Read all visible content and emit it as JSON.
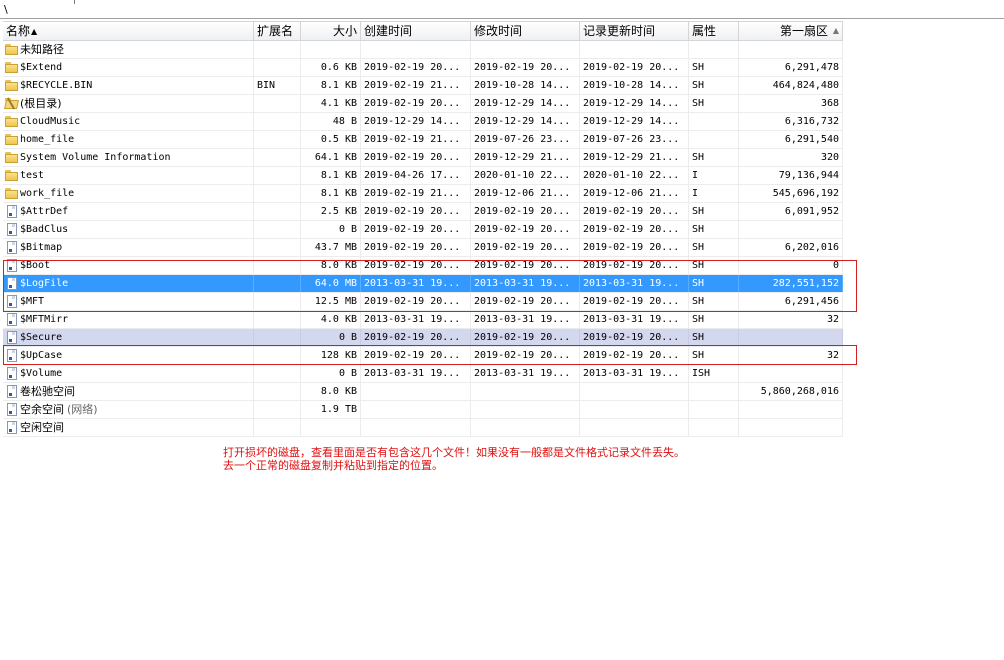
{
  "path_bar": {
    "text": "\\"
  },
  "columns": [
    "名称",
    "扩展名",
    "大小",
    "创建时间",
    "修改时间",
    "记录更新时间",
    "属性",
    "第一扇区"
  ],
  "rows": [
    {
      "name": "未知路径",
      "icon": "folder-icon",
      "ext": "",
      "size": "",
      "created": "",
      "modified": "",
      "updated": "",
      "attr": "",
      "sector": ""
    },
    {
      "name": "$Extend",
      "icon": "folder-icon",
      "ext": "",
      "size": "0.6 KB",
      "created": "2019-02-19  20...",
      "modified": "2019-02-19  20...",
      "updated": "2019-02-19  20...",
      "attr": "SH",
      "sector": "6,291,478"
    },
    {
      "name": "$RECYCLE.BIN",
      "icon": "folder-icon",
      "ext": "BIN",
      "size": "8.1 KB",
      "created": "2019-02-19  21...",
      "modified": "2019-10-28  14...",
      "updated": "2019-10-28  14...",
      "attr": "SH",
      "sector": "464,824,480"
    },
    {
      "name": "(根目录)",
      "icon": "root-folder-icon",
      "ext": "",
      "size": "4.1 KB",
      "created": "2019-02-19  20...",
      "modified": "2019-12-29  14...",
      "updated": "2019-12-29  14...",
      "attr": "SH",
      "sector": "368"
    },
    {
      "name": "CloudMusic",
      "icon": "folder-icon",
      "ext": "",
      "size": "48 B",
      "created": "2019-12-29  14...",
      "modified": "2019-12-29  14...",
      "updated": "2019-12-29  14...",
      "attr": "",
      "sector": "6,316,732"
    },
    {
      "name": "home_file",
      "icon": "folder-icon",
      "ext": "",
      "size": "0.5 KB",
      "created": "2019-02-19  21...",
      "modified": "2019-07-26  23...",
      "updated": "2019-07-26  23...",
      "attr": "",
      "sector": "6,291,540"
    },
    {
      "name": "System Volume Information",
      "icon": "folder-icon",
      "ext": "",
      "size": "64.1 KB",
      "created": "2019-02-19  20...",
      "modified": "2019-12-29  21...",
      "updated": "2019-12-29  21...",
      "attr": "SH",
      "sector": "320"
    },
    {
      "name": "test",
      "icon": "folder-icon",
      "ext": "",
      "size": "8.1 KB",
      "created": "2019-04-26  17...",
      "modified": "2020-01-10  22...",
      "updated": "2020-01-10  22...",
      "attr": "I",
      "sector": "79,136,944"
    },
    {
      "name": "work_file",
      "icon": "folder-icon",
      "ext": "",
      "size": "8.1 KB",
      "created": "2019-02-19  21...",
      "modified": "2019-12-06  21...",
      "updated": "2019-12-06  21...",
      "attr": "I",
      "sector": "545,696,192"
    },
    {
      "name": "$AttrDef",
      "icon": "file-icon",
      "ext": "",
      "size": "2.5 KB",
      "created": "2019-02-19  20...",
      "modified": "2019-02-19  20...",
      "updated": "2019-02-19  20...",
      "attr": "SH",
      "sector": "6,091,952"
    },
    {
      "name": "$BadClus",
      "icon": "file-icon",
      "ext": "",
      "size": "0 B",
      "created": "2019-02-19  20...",
      "modified": "2019-02-19  20...",
      "updated": "2019-02-19  20...",
      "attr": "SH",
      "sector": ""
    },
    {
      "name": "$Bitmap",
      "icon": "file-icon",
      "ext": "",
      "size": "43.7 MB",
      "created": "2019-02-19  20...",
      "modified": "2019-02-19  20...",
      "updated": "2019-02-19  20...",
      "attr": "SH",
      "sector": "6,202,016"
    },
    {
      "name": "$Boot",
      "icon": "file-icon",
      "ext": "",
      "size": "8.0 KB",
      "created": "2019-02-19  20...",
      "modified": "2019-02-19  20...",
      "updated": "2019-02-19  20...",
      "attr": "SH",
      "sector": "0"
    },
    {
      "name": "$LogFile",
      "icon": "file-icon",
      "ext": "",
      "size": "64.0 MB",
      "created": "2013-03-31  19...",
      "modified": "2013-03-31  19...",
      "updated": "2013-03-31  19...",
      "attr": "SH",
      "sector": "282,551,152",
      "state": "selected"
    },
    {
      "name": "$MFT",
      "icon": "file-icon",
      "ext": "",
      "size": "12.5 MB",
      "created": "2019-02-19  20...",
      "modified": "2019-02-19  20...",
      "updated": "2019-02-19  20...",
      "attr": "SH",
      "sector": "6,291,456"
    },
    {
      "name": "$MFTMirr",
      "icon": "file-icon",
      "ext": "",
      "size": "4.0 KB",
      "created": "2013-03-31  19...",
      "modified": "2013-03-31  19...",
      "updated": "2013-03-31  19...",
      "attr": "SH",
      "sector": "32"
    },
    {
      "name": "$Secure",
      "icon": "file-icon",
      "ext": "",
      "size": "0 B",
      "created": "2019-02-19  20...",
      "modified": "2019-02-19  20...",
      "updated": "2019-02-19  20...",
      "attr": "SH",
      "sector": "",
      "state": "highlight"
    },
    {
      "name": "$UpCase",
      "icon": "file-icon",
      "ext": "",
      "size": "128 KB",
      "created": "2019-02-19  20...",
      "modified": "2019-02-19  20...",
      "updated": "2019-02-19  20...",
      "attr": "SH",
      "sector": "32"
    },
    {
      "name": "$Volume",
      "icon": "file-icon",
      "ext": "",
      "size": "0 B",
      "created": "2013-03-31  19...",
      "modified": "2013-03-31  19...",
      "updated": "2013-03-31  19...",
      "attr": "ISH",
      "sector": ""
    },
    {
      "name": "卷松驰空间",
      "icon": "file-icon",
      "ext": "",
      "size": "8.0 KB",
      "created": "",
      "modified": "",
      "updated": "",
      "attr": "",
      "sector": "5,860,268,016"
    },
    {
      "name": "空余空间",
      "suffix": "(网络)",
      "icon": "file-icon",
      "ext": "",
      "size": "1.9 TB",
      "created": "",
      "modified": "",
      "updated": "",
      "attr": "",
      "sector": ""
    },
    {
      "name": "空闲空间",
      "icon": "file-icon",
      "ext": "",
      "size": "",
      "created": "",
      "modified": "",
      "updated": "",
      "attr": "",
      "sector": ""
    }
  ],
  "annotation": {
    "line1": "打开损坏的磁盘，查看里面是否有包含这几个文件！如果没有一般都是文件格式记录文件丢失。",
    "line2": "去一个正常的磁盘复制并粘贴到指定的位置。",
    "color": "#e01010"
  },
  "colors": {
    "selection": "#3399ff",
    "highlight": "#d4d8ef",
    "box": "#d22020"
  }
}
